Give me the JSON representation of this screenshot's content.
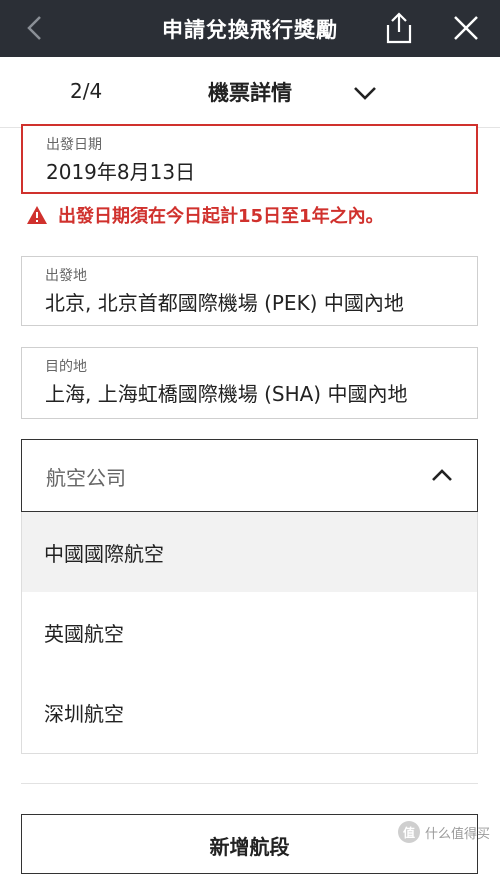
{
  "header": {
    "title": "申請兌換飛行獎勵",
    "icons": [
      "back-arrow-icon",
      "share-icon",
      "close-icon"
    ]
  },
  "steps": {
    "indicator": "2/4",
    "title": "機票詳情"
  },
  "form": {
    "departure_date": {
      "label": "出發日期",
      "value": "2019年8月13日",
      "error": "出發日期須在今日起計15日至1年之內。"
    },
    "origin": {
      "label": "出發地",
      "value": "北京, 北京首都國際機場 (PEK) 中國內地"
    },
    "destination": {
      "label": "目的地",
      "value": "上海, 上海虹橋國際機場 (SHA) 中國內地"
    },
    "airline": {
      "placeholder": "航空公司",
      "options": [
        "中國國際航空",
        "英國航空",
        "深圳航空"
      ]
    }
  },
  "actions": {
    "add_segment": "新增航段"
  },
  "watermark": {
    "badge": "值",
    "text": "什么值得买"
  },
  "colors": {
    "header_bg": "#2b2f36",
    "error": "#d0312d",
    "option_highlight": "#f2f2f2"
  }
}
